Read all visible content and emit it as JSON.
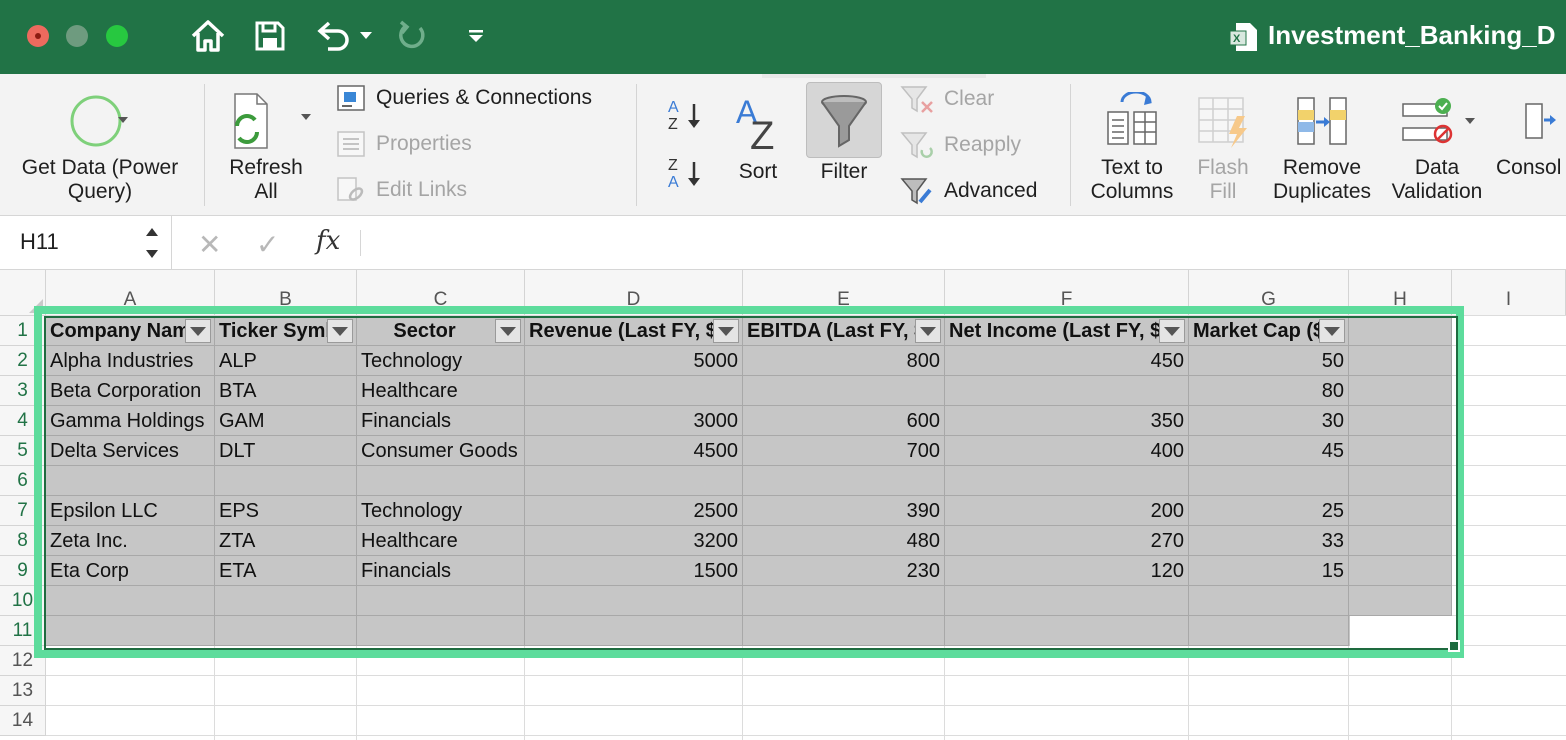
{
  "window": {
    "title": "Investment_Banking_D",
    "colors": {
      "titlebar": "#217346",
      "selection_outline": "#5ddc9c"
    }
  },
  "titlebar_icons": [
    "home-icon",
    "save-icon",
    "undo-icon",
    "redo-icon",
    "customize-toolbar-icon"
  ],
  "ribbon": {
    "get_data": "Get Data (Power Query)",
    "refresh_all": "Refresh All",
    "queries_connections": "Queries & Connections",
    "properties": "Properties",
    "edit_links": "Edit Links",
    "sort": "Sort",
    "filter": "Filter",
    "clear": "Clear",
    "reapply": "Reapply",
    "advanced": "Advanced",
    "text_to_columns": "Text to Columns",
    "flash_fill": "Flash Fill",
    "remove_duplicates": "Remove Duplicates",
    "data_validation": "Data Validation",
    "consolidate": "Consol"
  },
  "formula_bar": {
    "name_box": "H11",
    "fx": "fx",
    "formula": ""
  },
  "sheet": {
    "columns": [
      "A",
      "B",
      "C",
      "D",
      "E",
      "F",
      "G",
      "H",
      "I"
    ],
    "rows": [
      "1",
      "2",
      "3",
      "4",
      "5",
      "6",
      "7",
      "8",
      "9",
      "10",
      "11",
      "12",
      "13",
      "14"
    ],
    "headers": [
      "Company Nam",
      "Ticker Symb",
      "Sector",
      "Revenue (Last FY, $I",
      "EBITDA (Last FY, $I",
      "Net Income (Last FY, $I",
      "Market Cap ($"
    ],
    "data": [
      [
        "Alpha Industries",
        "ALP",
        "Technology",
        "5000",
        "800",
        "450",
        "50"
      ],
      [
        "Beta Corporation",
        "BTA",
        "Healthcare",
        "",
        "",
        "",
        "80"
      ],
      [
        "Gamma Holdings",
        "GAM",
        "Financials",
        "3000",
        "600",
        "350",
        "30"
      ],
      [
        "Delta Services",
        "DLT",
        "Consumer Goods",
        "4500",
        "700",
        "400",
        "45"
      ],
      [
        "",
        "",
        "",
        "",
        "",
        "",
        ""
      ],
      [
        "Epsilon LLC",
        "EPS",
        "Technology",
        "2500",
        "390",
        "200",
        "25"
      ],
      [
        "Zeta Inc.",
        "ZTA",
        "Healthcare",
        "3200",
        "480",
        "270",
        "33"
      ],
      [
        "Eta Corp",
        "ETA",
        "Financials",
        "1500",
        "230",
        "120",
        "15"
      ],
      [
        "",
        "",
        "",
        "",
        "",
        "",
        ""
      ],
      [
        "",
        "",
        "",
        "",
        "",
        "",
        ""
      ]
    ]
  }
}
